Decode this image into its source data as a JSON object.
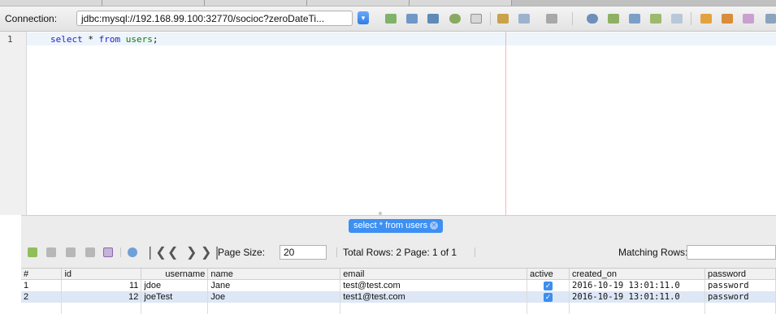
{
  "toolbar": {
    "connection_label": "Connection:",
    "connection_value": "jdbc:mysql://192.168.99.100:32770/socioc?zeroDateTi..."
  },
  "editor": {
    "line_number": "1",
    "code": {
      "kw1": "select",
      "star": " * ",
      "kw2": "from",
      "table": "users",
      "end": ";"
    }
  },
  "output": {
    "result_tab_label": "select * from users",
    "page_size_label": "Page Size:",
    "page_size_value": "20",
    "total_rows_text": "Total Rows: 2  Page: 1 of 1",
    "matching_rows_label": "Matching Rows:"
  },
  "grid": {
    "columns": [
      "#",
      "id",
      "username",
      "name",
      "email",
      "active",
      "created_on",
      "password"
    ],
    "rows": [
      {
        "n": "1",
        "id": "11",
        "username": "jdoe",
        "name": "Jane",
        "email": "test@test.com",
        "active": true,
        "created_on": "2016-10-19 13:01:11.0",
        "password": "password"
      },
      {
        "n": "2",
        "id": "12",
        "username": "joeTest",
        "name": "Joe",
        "email": "test1@test.com",
        "active": true,
        "created_on": "2016-10-19 13:01:11.0",
        "password": "password"
      }
    ]
  },
  "colors": {
    "accent": "#3d8ff2",
    "keyword": "#1d23c9",
    "identifier": "#0a7d0a"
  },
  "icons": [
    "dropdown-icon",
    "run-icon",
    "stop-icon",
    "refresh-icon",
    "first-page-icon",
    "prev-page-icon",
    "next-page-icon",
    "last-page-icon",
    "close-icon",
    "checkbox-checked-icon"
  ]
}
